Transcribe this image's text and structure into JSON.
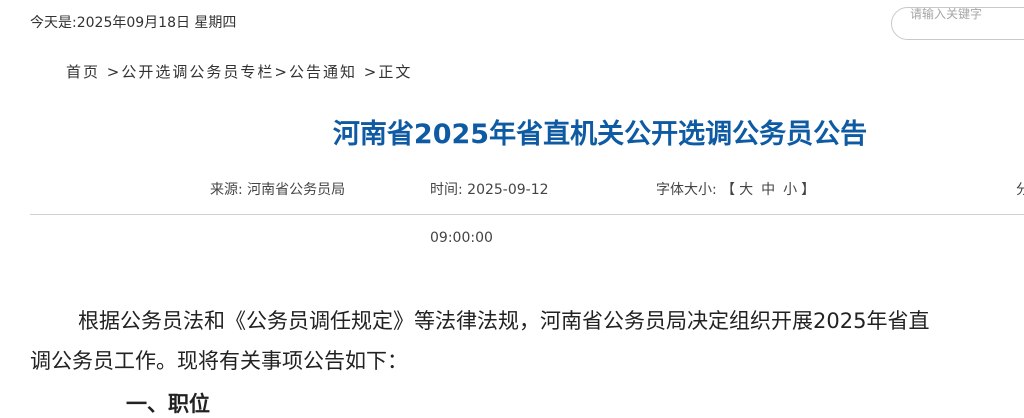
{
  "header": {
    "date_text": "今天是:2025年09月18日 星期四",
    "search_placeholder": "请输入关键字"
  },
  "breadcrumb": {
    "home": "首页",
    "column": "公开选调公务员专栏",
    "category": "公告通知",
    "current": "正文",
    "separator": ">"
  },
  "article": {
    "title": "河南省2025年省直机关公开选调公务员公告",
    "source_label": "来源:",
    "source_value": "河南省公务员局",
    "time_label": "时间:",
    "date": "2025-09-12",
    "time": "09:00:00",
    "font_size_label": "字体大小:",
    "font_size_open": "【",
    "font_size_large": "大",
    "font_size_medium": "中",
    "font_size_small": "小",
    "font_size_close": "】",
    "share_partial": "分",
    "paragraph_1": "根据公务员法和《公务员调任规定》等法律法规，河南省公务员局决定组织开展2025年省直",
    "paragraph_2": "调公务员工作。现将有关事项公告如下：",
    "section_heading_partial": "一、职位"
  }
}
